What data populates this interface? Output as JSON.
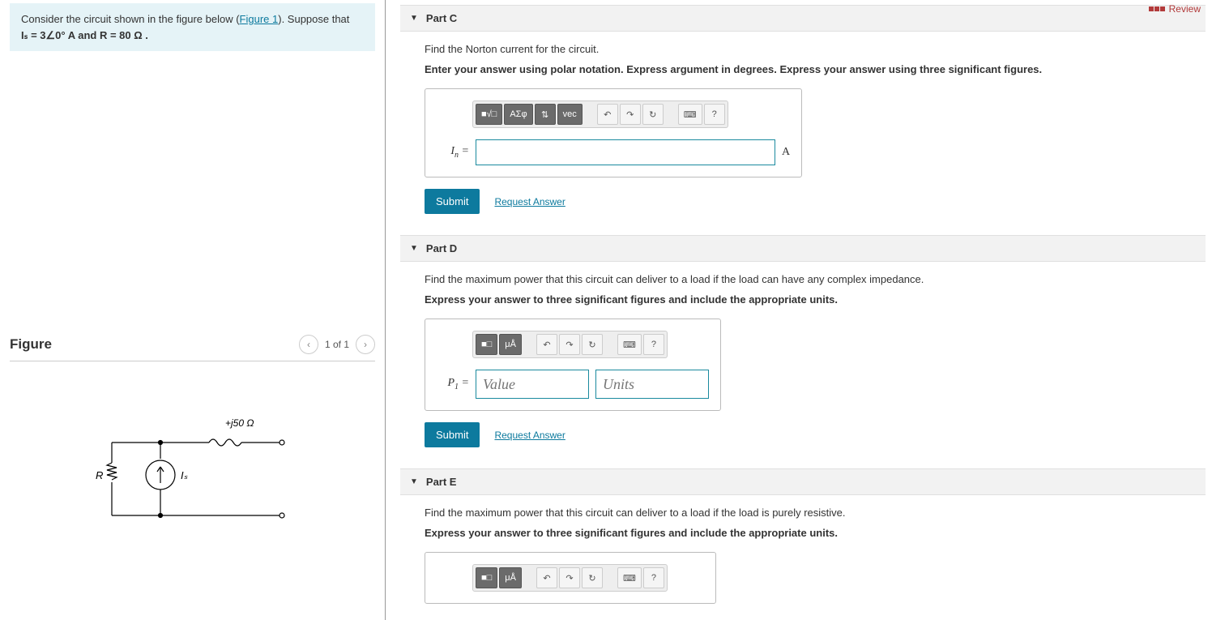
{
  "top": {
    "review": "Review"
  },
  "intro": {
    "text_pre": "Consider the circuit shown in the figure below (",
    "fig_link": "Figure 1",
    "text_mid": "). Suppose that ",
    "eq": "Iₛ = 3∠0° A and R = 80 Ω ."
  },
  "figure": {
    "heading": "Figure",
    "nav": "1 of 1",
    "labels": {
      "ind": "+j50 Ω",
      "R": "R",
      "Is": "Iₛ"
    }
  },
  "parts": {
    "c": {
      "title": "Part C",
      "prompt": "Find the Norton current for the circuit.",
      "instr": "Enter your answer using polar notation. Express argument in degrees. Express your answer using three significant figures.",
      "var": "I",
      "sub": "n",
      "unit": "A"
    },
    "d": {
      "title": "Part D",
      "prompt": "Find the maximum power that this circuit can deliver to a load if the load can have any complex impedance.",
      "instr": "Express your answer to three significant figures and include the appropriate units.",
      "var": "P",
      "sub": "1",
      "value_ph": "Value",
      "units_ph": "Units"
    },
    "e": {
      "title": "Part E",
      "prompt": "Find the maximum power that this circuit can deliver to a load if the load  is purely resistive.",
      "instr": "Express your answer to three significant figures and include the appropriate units."
    }
  },
  "tb": {
    "frac": "■√□",
    "greek": "ΑΣφ",
    "updown": "⇅",
    "vec": "vec",
    "undo": "↶",
    "redo": "↷",
    "reset": "↻",
    "kbd": "⌨",
    "help": "?",
    "units1": "■□",
    "units2": "μÅ"
  },
  "btns": {
    "submit": "Submit",
    "request": "Request Answer"
  }
}
